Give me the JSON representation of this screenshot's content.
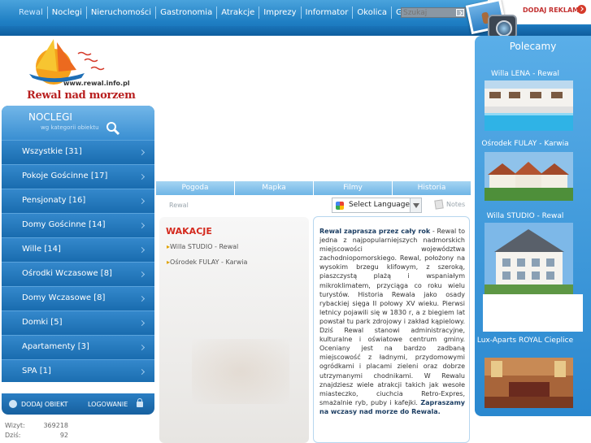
{
  "nav": {
    "items": [
      "Rewal",
      "Noclegi",
      "Nieruchomości",
      "Gastronomia",
      "Atrakcje",
      "Imprezy",
      "Informator",
      "Okolica",
      "Galeria"
    ],
    "search_placeholder": "Szukaj",
    "add_ad": "DODAJ REKLAMĘ"
  },
  "logo": {
    "url": "www.rewal.info.pl",
    "name": "Rewal nad morzem"
  },
  "left": {
    "title": "NOCLEGI",
    "subtitle": "wg kategorii obiektu",
    "categories": [
      "Wszystkie [31]",
      "Pokoje Gościnne [17]",
      "Pensjonaty [16]",
      "Domy Gościnne [14]",
      "Wille [14]",
      "Ośrodki Wczasowe [8]",
      "Domy Wczasowe [8]",
      "Domki [5]",
      "Apartamenty [3]",
      "SPA [1]"
    ],
    "add_object": "DODAJ OBIEKT",
    "login": "LOGOWANIE"
  },
  "stats": {
    "visits_label": "Wizyt:",
    "visits_value": "369218",
    "today_label": "Dziś:",
    "today_value": "92"
  },
  "tabs": [
    "Pogoda",
    "Mapka",
    "Filmy",
    "Historia"
  ],
  "toolbar": {
    "breadcrumb": "Rewal",
    "language": "Select Language",
    "notes": "Notes"
  },
  "wakacje": {
    "title": "WAKACJE",
    "items": [
      "Willa STUDIO - Rewal",
      "Ośrodek FULAY - Karwia"
    ]
  },
  "article": {
    "lead": "Rewal zaprasza przez cały rok",
    "body": " - Rewal to jedna z najpopularniejszych nadmorskich miejscowości województwa zachodniopomorskiego. Rewal, położony na wysokim brzegu klifowym, z szeroką, piaszczystą plażą i wspaniałym mikroklimatem, przyciąga co roku wielu turystów. Historia Rewala jako osady rybackiej sięga II połowy XV wieku. Pierwsi letnicy pojawili się w 1830 r, a z biegiem lat powstał tu park zdrojowy i zakład kąpielowy. Dziś Rewal stanowi administracyjne, kulturalne i oświatowe centrum gminy. Oceniany jest na bardzo zadbaną miejscowość z ładnymi, przydomowymi ogródkami i placami zieleni oraz dobrze utrzymanymi chodnikami. W Rewalu znajdziesz wiele atrakcji takich jak wesołe miasteczko, ciuchcia Retro-Expres, smażalnie ryb, puby i kafejki. ",
    "closing": "Zapraszamy na wczasy nad morze do Rewala."
  },
  "right": {
    "title": "Polecamy",
    "cards": [
      {
        "name": "Willa LENA - Rewal"
      },
      {
        "name": "Ośrodek FULAY - Karwia"
      },
      {
        "name": "Willa STUDIO - Rewal"
      },
      {
        "name": "Lux-Aparts ROYAL Cieplice"
      }
    ]
  },
  "colors": {
    "nav_blue": "#1f7fc4",
    "panel_blue": "#1a6db0",
    "accent_red": "#d42a1e",
    "logo_red": "#b81f1f"
  }
}
